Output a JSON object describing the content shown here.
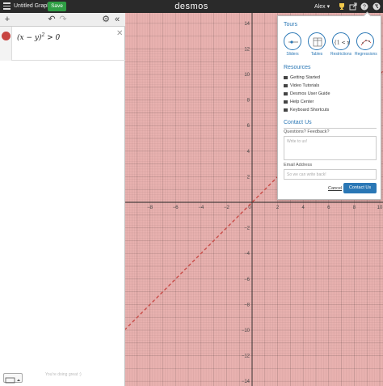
{
  "header": {
    "graph_title": "Untitled Graph",
    "save_label": "Save",
    "logo": "desmos",
    "user_label": "Alex",
    "icons": [
      "menu-icon",
      "trophy-icon",
      "share-icon",
      "help-icon",
      "globe-icon"
    ],
    "accent_color": "#2f9e44"
  },
  "expression_panel": {
    "toolbar": {
      "add_icon": "+",
      "undo_icon": "↶",
      "redo_icon": "↷",
      "settings_icon": "⚙",
      "collapse_icon": "«"
    },
    "expressions": [
      {
        "index": "1",
        "latex_base": "(x − y)",
        "latex_exp": "2",
        "latex_rest": " > 0",
        "color": "#c74440"
      }
    ],
    "close_icon": "✕",
    "footer_hint": "You're doing great :)"
  },
  "graph": {
    "x_ticks": [
      "−8",
      "−6",
      "−4",
      "−2",
      "0",
      "2",
      "4",
      "6",
      "8",
      "10"
    ],
    "y_ticks": [
      "14",
      "12",
      "10",
      "8",
      "6",
      "4",
      "2",
      "−2",
      "−4",
      "−6",
      "−8",
      "−10",
      "−12",
      "−14"
    ],
    "shade_color": "#c74440"
  },
  "help_popover": {
    "tours_heading": "Tours",
    "tours": [
      {
        "label": "Sliders",
        "icon": "slider-icon"
      },
      {
        "label": "Tables",
        "icon": "table-icon"
      },
      {
        "label": "Restrictions",
        "icon": "restriction-icon",
        "glyph": "{1 < x"
      },
      {
        "label": "Regressions",
        "icon": "regression-icon"
      }
    ],
    "resources_heading": "Resources",
    "resources": [
      {
        "label": "Getting Started",
        "icon": "rocket-icon"
      },
      {
        "label": "Video Tutorials",
        "icon": "video-icon"
      },
      {
        "label": "Desmos User Guide",
        "icon": "book-icon"
      },
      {
        "label": "Help Center",
        "icon": "chat-icon"
      },
      {
        "label": "Keyboard Shortcuts",
        "icon": "keyboard-icon"
      }
    ],
    "contact_heading": "Contact Us",
    "feedback_label": "Questions? Feedback?",
    "feedback_placeholder": "Write to us!",
    "email_label": "Email Address",
    "email_placeholder": "So we can write back!",
    "cancel_label": "Cancel",
    "submit_label": "Contact Us",
    "accent_color": "#2a77b5"
  }
}
